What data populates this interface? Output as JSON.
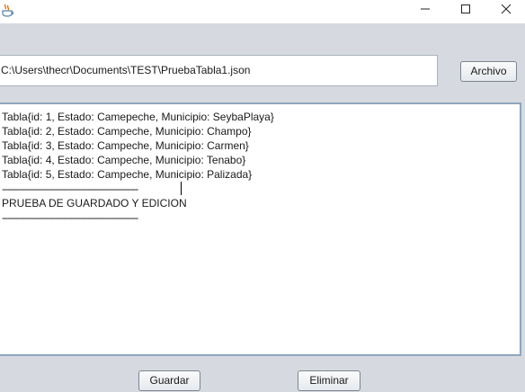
{
  "titlebar": {
    "app_icon": "java-cup-icon",
    "minimize_icon": "minimize-icon",
    "maximize_icon": "maximize-icon",
    "close_icon": "close-icon"
  },
  "file_path": {
    "value": "C:\\Users\\thecr\\Documents\\TEST\\PruebaTabla1.json"
  },
  "buttons": {
    "archivo": "Archivo",
    "guardar": "Guardar",
    "eliminar": "Eliminar"
  },
  "text_area": {
    "lines": [
      "Tabla{id: 1, Estado: Camepeche, Municipio: SeybaPlaya}",
      "Tabla{id: 2, Estado: Campeche, Municipio: Champo}",
      "Tabla{id: 3, Estado: Campeche, Municipio: Carmen}",
      "Tabla{id: 4, Estado: Campeche, Municipio: Tenabo}",
      "Tabla{id: 5, Estado: Campeche, Municipio: Palizada}",
      "------------------------------------------------------",
      "PRUEBA DE GUARDADO Y EDICION",
      "------------------------------------------------------"
    ]
  }
}
